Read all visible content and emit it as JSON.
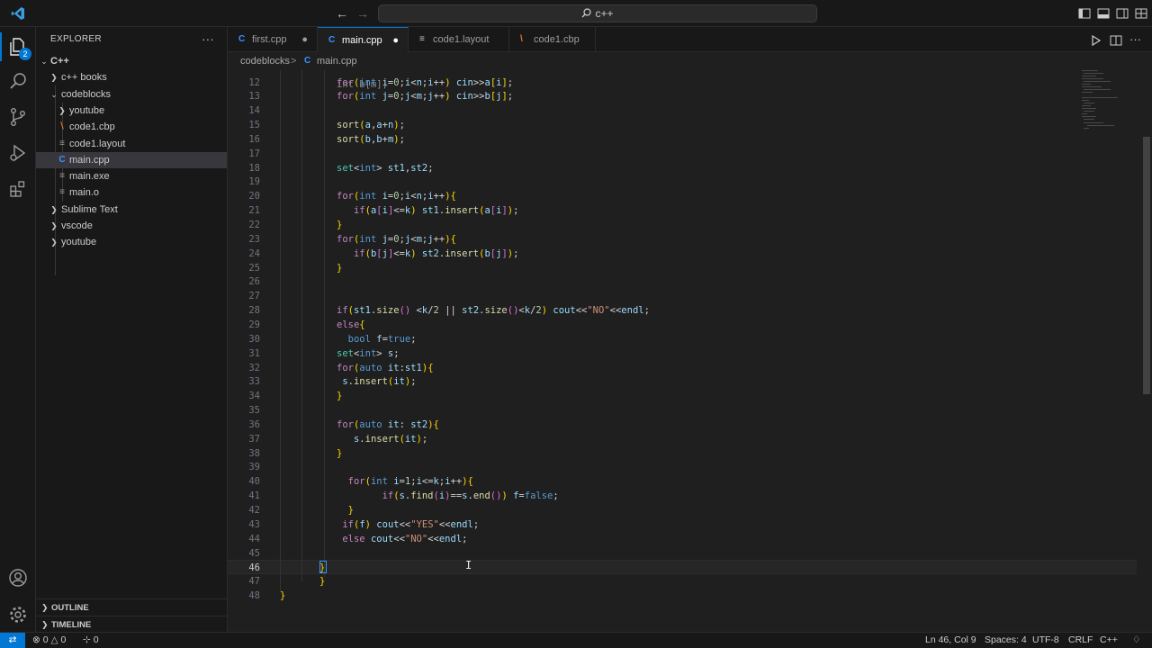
{
  "titlebar": {
    "command_center": "c++",
    "back_icon": "arrow-left-icon",
    "forward_icon": "arrow-right-icon"
  },
  "activity": {
    "explorer_badge": "2",
    "items": [
      "explorer-icon",
      "search-icon",
      "source-control-icon",
      "run-debug-icon",
      "extensions-icon"
    ],
    "bottom": [
      "account-icon",
      "manage-gear-icon"
    ]
  },
  "sidebar": {
    "title": "EXPLORER",
    "more": "···",
    "root": "C++",
    "tree": [
      {
        "label": "c++ books",
        "type": "folder",
        "expanded": false,
        "depth": 1
      },
      {
        "label": "codeblocks",
        "type": "folder",
        "expanded": true,
        "depth": 1
      },
      {
        "label": "youtube",
        "type": "folder",
        "expanded": false,
        "depth": 2
      },
      {
        "label": "code1.cbp",
        "type": "xml",
        "depth": 2
      },
      {
        "label": "code1.layout",
        "type": "text",
        "depth": 2
      },
      {
        "label": "main.cpp",
        "type": "cpp",
        "depth": 2,
        "selected": true
      },
      {
        "label": "main.exe",
        "type": "text",
        "depth": 2
      },
      {
        "label": "main.o",
        "type": "text",
        "depth": 2
      },
      {
        "label": "Sublime Text",
        "type": "folder",
        "expanded": false,
        "depth": 1
      },
      {
        "label": "vscode",
        "type": "folder",
        "expanded": false,
        "depth": 1
      },
      {
        "label": "youtube",
        "type": "folder",
        "expanded": false,
        "depth": 1
      }
    ],
    "outline": "OUTLINE",
    "timeline": "TIMELINE"
  },
  "tabs": [
    {
      "label": "first.cpp",
      "icon": "C",
      "dirty": true,
      "active": false
    },
    {
      "label": "main.cpp",
      "icon": "C",
      "dirty": true,
      "active": true
    },
    {
      "label": "code1.layout",
      "icon": "≡",
      "dirty": false,
      "active": false
    },
    {
      "label": "code1.cbp",
      "icon": "\\",
      "dirty": false,
      "active": false
    }
  ],
  "breadcrumb": {
    "folder": "codeblocks",
    "sep": ">",
    "file": "main.cpp"
  },
  "editor": {
    "partial_top": "int b[m];",
    "lines": [
      {
        "n": "12",
        "t": "for(int i=0;i<n;i++) cin>>a[i];"
      },
      {
        "n": "13",
        "t": "for(int j=0;j<m;j++) cin>>b[j];"
      },
      {
        "n": "14",
        "t": ""
      },
      {
        "n": "15",
        "t": "sort(a,a+n);"
      },
      {
        "n": "16",
        "t": "sort(b,b+m);"
      },
      {
        "n": "17",
        "t": ""
      },
      {
        "n": "18",
        "t": "set<int> st1,st2;"
      },
      {
        "n": "19",
        "t": ""
      },
      {
        "n": "20",
        "t": "for(int i=0;i<n;i++){"
      },
      {
        "n": "21",
        "t": "   if(a[i]<=k) st1.insert(a[i]);"
      },
      {
        "n": "22",
        "t": "}"
      },
      {
        "n": "23",
        "t": "for(int j=0;j<m;j++){"
      },
      {
        "n": "24",
        "t": "   if(b[j]<=k) st2.insert(b[j]);"
      },
      {
        "n": "25",
        "t": "}"
      },
      {
        "n": "26",
        "t": ""
      },
      {
        "n": "27",
        "t": ""
      },
      {
        "n": "28",
        "t": "if(st1.size() <k/2 || st2.size()<k/2) cout<<\"NO\"<<endl;"
      },
      {
        "n": "29",
        "t": "else{"
      },
      {
        "n": "30",
        "t": "  bool f=true;"
      },
      {
        "n": "31",
        "t": "set<int> s;"
      },
      {
        "n": "32",
        "t": "for(auto it:st1){"
      },
      {
        "n": "33",
        "t": " s.insert(it);"
      },
      {
        "n": "34",
        "t": "}"
      },
      {
        "n": "35",
        "t": ""
      },
      {
        "n": "36",
        "t": "for(auto it: st2){"
      },
      {
        "n": "37",
        "t": "   s.insert(it);"
      },
      {
        "n": "38",
        "t": "}"
      },
      {
        "n": "39",
        "t": ""
      },
      {
        "n": "40",
        "t": "  for(int i=1;i<=k;i++){"
      },
      {
        "n": "41",
        "t": "        if(s.find(i)==s.end()) f=false;"
      },
      {
        "n": "42",
        "t": "  }"
      },
      {
        "n": "43",
        "t": " if(f) cout<<\"YES\"<<endl;"
      },
      {
        "n": "44",
        "t": " else cout<<\"NO\"<<endl;"
      },
      {
        "n": "45",
        "t": ""
      },
      {
        "n": "46",
        "t": "}"
      },
      {
        "n": "47",
        "t": "}"
      },
      {
        "n": "48",
        "t": "}"
      }
    ],
    "current_line": "46"
  },
  "status": {
    "errors": "0",
    "warnings": "0",
    "ports": "0",
    "position": "Ln 46, Col 9",
    "spaces": "Spaces: 4",
    "encoding": "UTF-8",
    "eol": "CRLF",
    "language": "C++"
  },
  "colors": {
    "accent": "#0078d4",
    "editor_bg": "#1f1f1f",
    "sidebar_bg": "#181818"
  }
}
